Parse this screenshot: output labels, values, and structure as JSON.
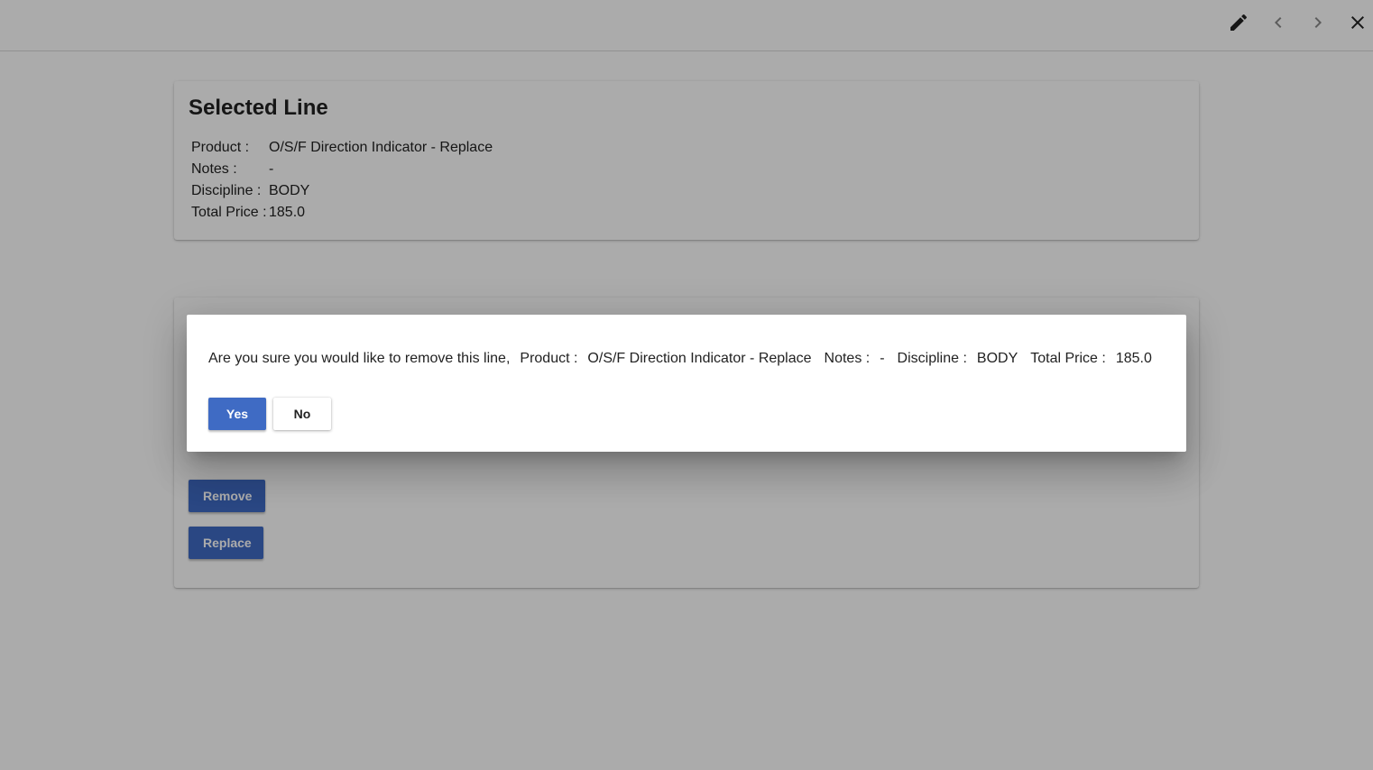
{
  "toolbar": {
    "icons": [
      "edit-icon",
      "chevron-left-icon",
      "chevron-right-icon",
      "close-icon"
    ]
  },
  "selected_line": {
    "title": "Selected Line",
    "product_label": "Product :",
    "product_value": "O/S/F Direction Indicator - Replace",
    "notes_label": "Notes :",
    "notes_value": "-",
    "discipline_label": "Discipline :",
    "discipline_value": "BODY",
    "total_price_label": "Total Price :",
    "total_price_value": "185.0"
  },
  "actions": {
    "remove_label": "Remove",
    "replace_label": "Replace"
  },
  "dialog": {
    "message": "Are you sure you would like to remove this line,",
    "product_label": "Product :",
    "product_value": "O/S/F Direction Indicator - Replace",
    "notes_label": "Notes :",
    "notes_value": "-",
    "discipline_label": "Discipline :",
    "discipline_value": "BODY",
    "total_price_label": "Total Price :",
    "total_price_value": "185.0",
    "yes_label": "Yes",
    "no_label": "No"
  },
  "colors": {
    "primary": "#3f6bc4",
    "overlay": "rgba(0,0,0,0.33)"
  }
}
